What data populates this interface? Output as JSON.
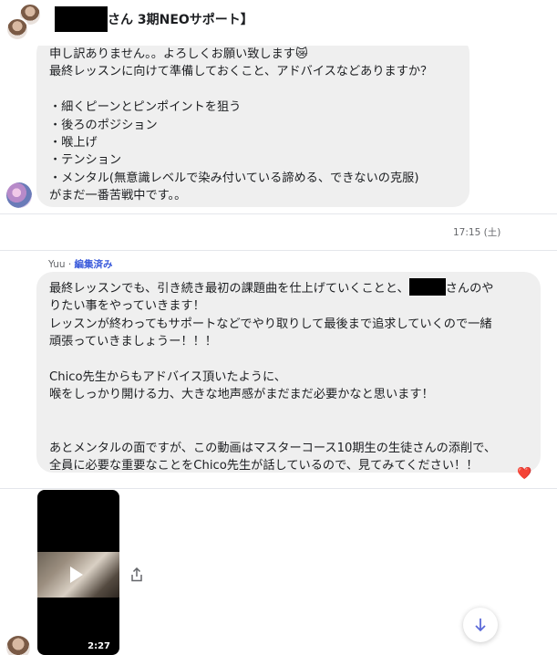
{
  "header": {
    "title_suffix": "さん 3期NEOサポート】"
  },
  "messages": [
    {
      "id": "m1",
      "text": "申し訳ありません。。よろしくお願い致します",
      "text2": "最終レッスンに向けて準備しておくこと、アドバイスなどありますか？\n\n・細くピーンとピンポイントを狙う\n・後ろのポジション\n・喉上げ\n・テンション\n・メンタル(無意識レベルで染み付いている諦める、できないの克服)\nがまだ一番苦戦中です。。",
      "emoji": "😿"
    },
    {
      "id": "m2",
      "sender": "Yuu",
      "sender_sep": " · ",
      "edited_label": "編集済み",
      "line1_pre": "最終レッスンでも、引き続き最初の課題曲を仕上げていくことと、",
      "line1_post": "さんのや",
      "rest": "りたい事をやっていきます！\nレッスンが終わってもサポートなどでやり取りして最後まで追求していくので一緒\n頑張っていきましょうー！！！\n\nChico先生からもアドバイス頂いたように、\n喉をしっかり開ける力、大きな地声感がまだまだ必要かなと思います！\n\n\nあとメンタルの面ですが、この動画はマスターコース10期生の生徒さんの添削で、\n全員に必要な重要なことをChico先生が話しているので、見てみてください！！",
      "reaction": "❤️"
    }
  ],
  "timestamp": "17:15 (土)",
  "video": {
    "duration": "2:27"
  },
  "icons": {
    "share": "share-icon",
    "scroll_down": "arrow-down-icon",
    "play": "play-icon"
  }
}
